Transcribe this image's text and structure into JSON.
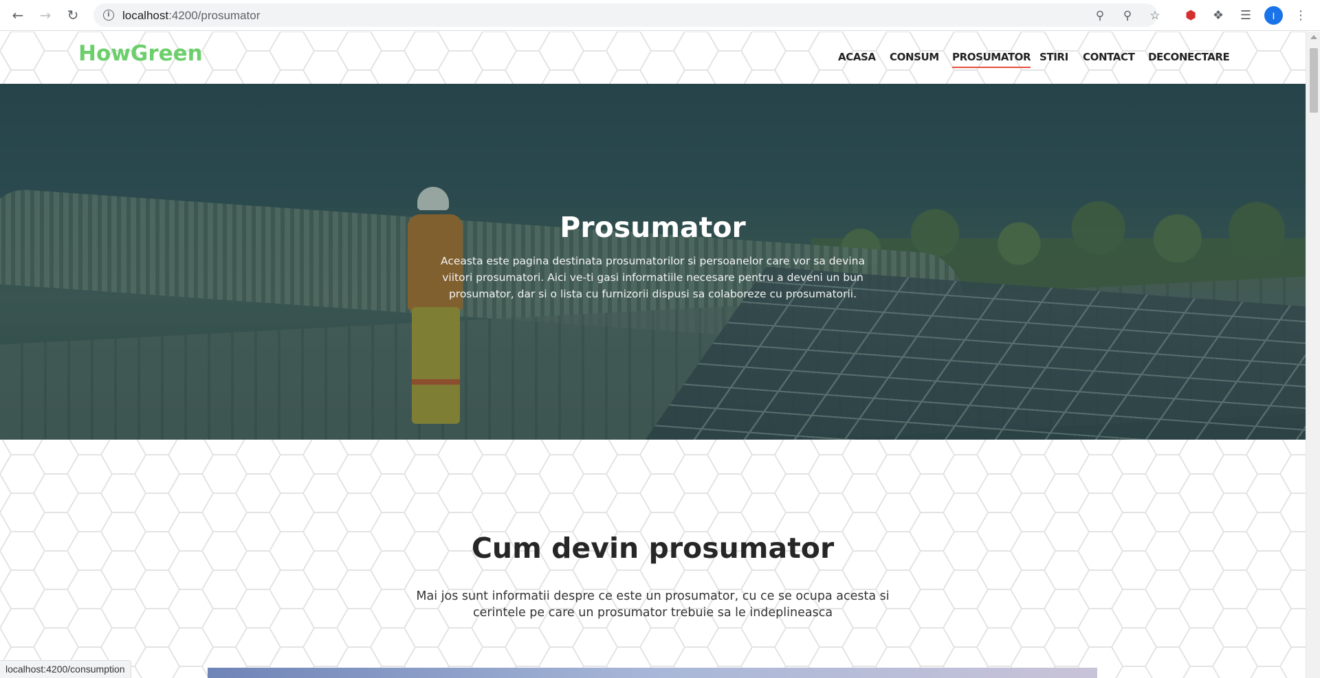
{
  "browser": {
    "url_host": "localhost",
    "url_path": ":4200/prosumator",
    "back_icon": "arrow-left",
    "forward_icon": "arrow-right",
    "reload_icon": "reload",
    "avatar_letter": "I",
    "status_url": "localhost:4200/consumption"
  },
  "header": {
    "logo": "HowGreen",
    "nav": [
      {
        "label": "ACASA",
        "active": false
      },
      {
        "label": "CONSUM",
        "active": false
      },
      {
        "label": "PROSUMATOR",
        "active": true
      },
      {
        "label": "STIRI",
        "active": false
      },
      {
        "label": "CONTACT",
        "active": false
      },
      {
        "label": "DECONECTARE",
        "active": false
      }
    ]
  },
  "hero": {
    "title": "Prosumator",
    "text": "Aceasta este pagina destinata prosumatorilor si persoanelor care vor sa devina viitori prosumatori. Aici ve-ti gasi informatiile necesare pentru a deveni un bun prosumator, dar si o lista cu furnizorii dispusi sa colaboreze cu prosumatorii."
  },
  "section": {
    "title": "Cum devin prosumator",
    "text": "Mai jos sunt informatii despre ce este un prosumator, cu ce se ocupa acesta si cerintele pe care un prosumator trebuie sa le indeplineasca"
  },
  "colors": {
    "logo": "#6ccf6c",
    "active_underline": "#e74c3c",
    "avatar": "#1a73e8"
  }
}
